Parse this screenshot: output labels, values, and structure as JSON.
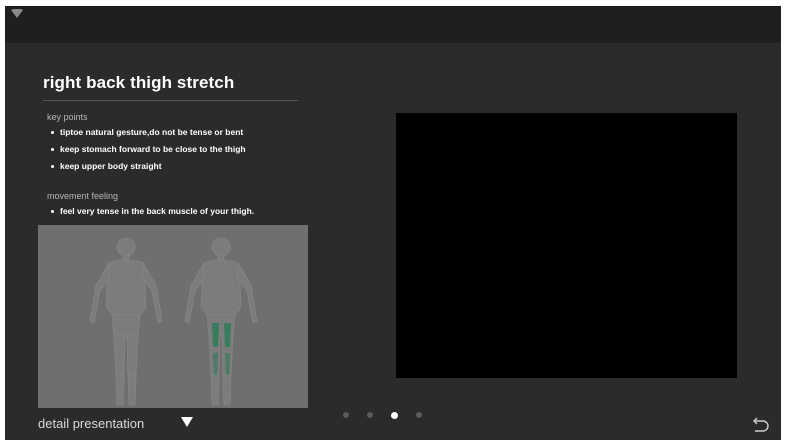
{
  "status_bar": {
    "wifi_icon": "wifi-icon"
  },
  "exercise": {
    "title": "right back thigh stretch",
    "key_points": {
      "heading": "key points",
      "items": [
        "tiptoe natural gesture,do not be tense or bent",
        "keep stomach forward to be close to the thigh",
        "keep upper body straight"
      ]
    },
    "movement_feeling": {
      "heading": "movement feeling",
      "items": [
        "feel very tense in the back muscle of your thigh."
      ]
    }
  },
  "anatomy": {
    "views": [
      "front-view",
      "back-view"
    ],
    "highlighted_muscle": "hamstring",
    "highlight_color": "#2f7d5a"
  },
  "video": {
    "background_color": "#000000"
  },
  "footer": {
    "detail_label": "detail presentation",
    "expand_icon": "triangle-down-icon",
    "back_icon": "return-icon"
  },
  "pager": {
    "total": 4,
    "active_index": 2
  },
  "colors": {
    "screen_bg": "#2b2b2b",
    "status_bar_bg": "#1f1f1f",
    "text_primary": "#ffffff",
    "text_secondary": "#b5b5b5"
  }
}
